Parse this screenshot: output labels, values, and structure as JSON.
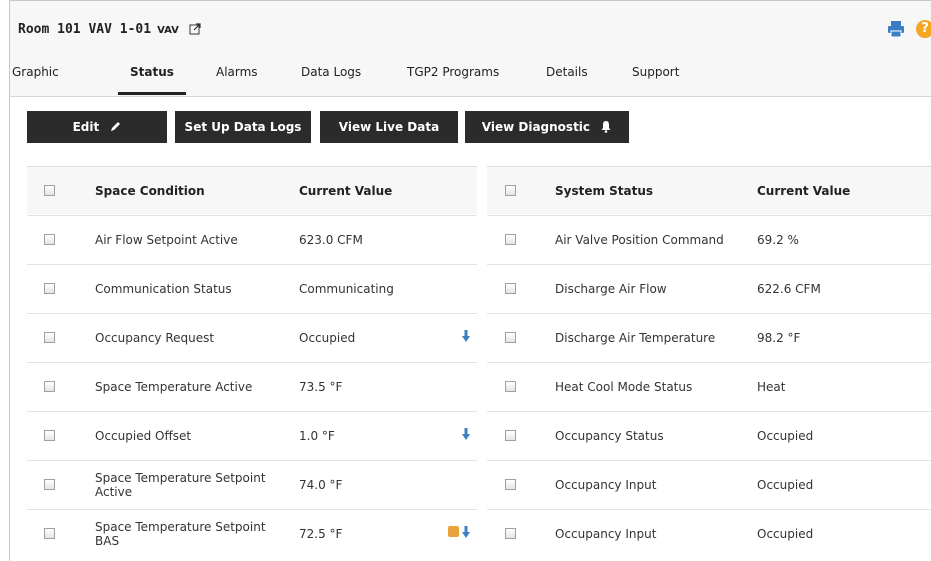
{
  "header": {
    "title": "Room 101 VAV 1-01",
    "type_badge": "VAV"
  },
  "tabs": [
    {
      "label": "Graphic"
    },
    {
      "label": "Status"
    },
    {
      "label": "Alarms"
    },
    {
      "label": "Data Logs"
    },
    {
      "label": "TGP2 Programs"
    },
    {
      "label": "Details"
    },
    {
      "label": "Support"
    }
  ],
  "active_tab": "Status",
  "toolbar": {
    "edit_label": "Edit",
    "setup_logs_label": "Set Up Data Logs",
    "live_data_label": "View Live Data",
    "diagnostic_label": "View Diagnostic"
  },
  "space_condition": {
    "headers": {
      "name": "Space Condition",
      "value": "Current Value"
    },
    "rows": [
      {
        "name": "Air Flow Setpoint Active",
        "value": "623.0 CFM"
      },
      {
        "name": "Communication Status",
        "value": "Communicating"
      },
      {
        "name": "Occupancy Request",
        "value": "Occupied",
        "icons": [
          "arrow-down-icon"
        ]
      },
      {
        "name": "Space Temperature Active",
        "value": "73.5 °F"
      },
      {
        "name": "Occupied Offset",
        "value": "1.0 °F",
        "icons": [
          "arrow-down-icon"
        ]
      },
      {
        "name": "Space Temperature Setpoint Active",
        "value": "74.0 °F"
      },
      {
        "name": "Space Temperature Setpoint BAS",
        "value": "72.5 °F",
        "icons": [
          "override-icon",
          "arrow-down-icon"
        ]
      }
    ]
  },
  "system_status": {
    "headers": {
      "name": "System Status",
      "value": "Current Value"
    },
    "rows": [
      {
        "name": "Air Valve Position Command",
        "value": "69.2 %"
      },
      {
        "name": "Discharge Air Flow",
        "value": "622.6 CFM"
      },
      {
        "name": "Discharge Air Temperature",
        "value": "98.2 °F"
      },
      {
        "name": "Heat Cool Mode Status",
        "value": "Heat"
      },
      {
        "name": "Occupancy Status",
        "value": "Occupied"
      },
      {
        "name": "Occupancy Input",
        "value": "Occupied"
      },
      {
        "name": "Occupancy Input",
        "value": "Occupied"
      }
    ]
  },
  "colors": {
    "button_bg": "#2b2b2b",
    "print_icon": "#3b7fc4",
    "help_icon": "#f5a623",
    "arrow_icon": "#3b7fc4",
    "override_icon": "#e8a33a"
  }
}
